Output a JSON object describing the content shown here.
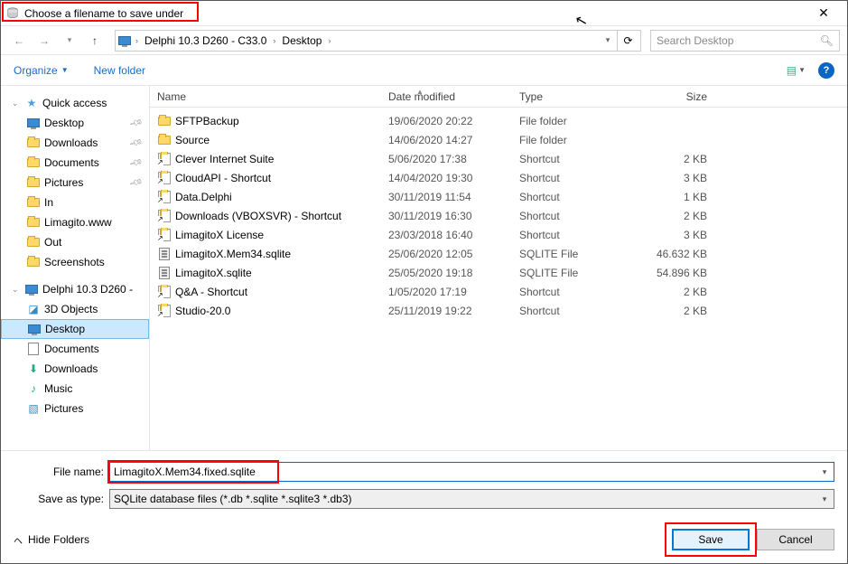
{
  "title": "Choose a filename to save under",
  "breadcrumb": {
    "seg1": "Delphi 10.3 D260 - C33.0",
    "seg2": "Desktop"
  },
  "search_placeholder": "Search Desktop",
  "toolbar": {
    "organize": "Organize",
    "newfolder": "New folder"
  },
  "sidebar": {
    "quick": "Quick access",
    "items_pinned": [
      {
        "label": "Desktop"
      },
      {
        "label": "Downloads"
      },
      {
        "label": "Documents"
      },
      {
        "label": "Pictures"
      }
    ],
    "items_recent": [
      {
        "label": "In"
      },
      {
        "label": "Limagito.www"
      },
      {
        "label": "Out"
      },
      {
        "label": "Screenshots"
      }
    ],
    "drive": "Delphi 10.3 D260 -",
    "drive_children": [
      {
        "label": "3D Objects",
        "icon": "cube"
      },
      {
        "label": "Desktop",
        "icon": "monitor",
        "selected": true
      },
      {
        "label": "Documents",
        "icon": "doc"
      },
      {
        "label": "Downloads",
        "icon": "down"
      },
      {
        "label": "Music",
        "icon": "music"
      },
      {
        "label": "Pictures",
        "icon": "pic"
      }
    ]
  },
  "columns": {
    "name": "Name",
    "date": "Date modified",
    "type": "Type",
    "size": "Size"
  },
  "files": [
    {
      "name": "SFTPBackup",
      "date": "19/06/2020 20:22",
      "type": "File folder",
      "size": "",
      "icon": "folder"
    },
    {
      "name": "Source",
      "date": "14/06/2020 14:27",
      "type": "File folder",
      "size": "",
      "icon": "folder"
    },
    {
      "name": "Clever Internet Suite",
      "date": "5/06/2020 17:38",
      "type": "Shortcut",
      "size": "2 KB",
      "icon": "shortcut"
    },
    {
      "name": "CloudAPI - Shortcut",
      "date": "14/04/2020 19:30",
      "type": "Shortcut",
      "size": "3 KB",
      "icon": "shortcut"
    },
    {
      "name": "Data.Delphi",
      "date": "30/11/2019 11:54",
      "type": "Shortcut",
      "size": "1 KB",
      "icon": "shortcut"
    },
    {
      "name": "Downloads (VBOXSVR) - Shortcut",
      "date": "30/11/2019 16:30",
      "type": "Shortcut",
      "size": "2 KB",
      "icon": "shortcut"
    },
    {
      "name": "LimagitoX License",
      "date": "23/03/2018 16:40",
      "type": "Shortcut",
      "size": "3 KB",
      "icon": "shortcut"
    },
    {
      "name": "LimagitoX.Mem34.sqlite",
      "date": "25/06/2020 12:05",
      "type": "SQLITE File",
      "size": "46.632 KB",
      "icon": "sqlite"
    },
    {
      "name": "LimagitoX.sqlite",
      "date": "25/05/2020 19:18",
      "type": "SQLITE File",
      "size": "54.896 KB",
      "icon": "sqlite"
    },
    {
      "name": "Q&A - Shortcut",
      "date": "1/05/2020 17:19",
      "type": "Shortcut",
      "size": "2 KB",
      "icon": "shortcut"
    },
    {
      "name": "Studio-20.0",
      "date": "25/11/2019 19:22",
      "type": "Shortcut",
      "size": "2 KB",
      "icon": "shortcut"
    }
  ],
  "form": {
    "filename_label": "File name:",
    "filename_value": "LimagitoX.Mem34.fixed.sqlite",
    "type_label": "Save as type:",
    "type_value": "SQLite database files (*.db *.sqlite *.sqlite3 *.db3)"
  },
  "buttons": {
    "hide": "Hide Folders",
    "save": "Save",
    "cancel": "Cancel"
  }
}
